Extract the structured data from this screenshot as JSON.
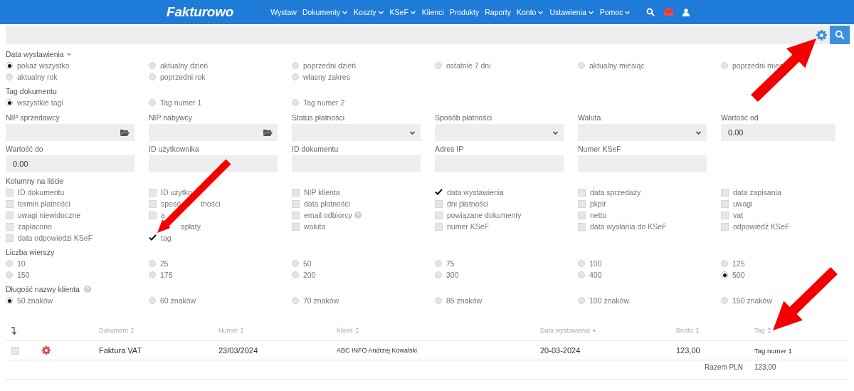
{
  "nav": {
    "logo": "Fakturowo",
    "items": [
      {
        "label": "Wystaw",
        "dropdown": false
      },
      {
        "label": "Dokumenty",
        "dropdown": true
      },
      {
        "label": "Koszty",
        "dropdown": true
      },
      {
        "label": "KSeF",
        "dropdown": true
      },
      {
        "label": "Klienci",
        "dropdown": false
      },
      {
        "label": "Produkty",
        "dropdown": false
      },
      {
        "label": "Raporty",
        "dropdown": false
      },
      {
        "label": "Konto",
        "dropdown": true
      },
      {
        "label": "Ustawienia",
        "dropdown": true
      },
      {
        "label": "Pomoc",
        "dropdown": true
      }
    ]
  },
  "date_filter": {
    "label": "Data wystawienia",
    "options": [
      {
        "label": "pokaż wszystko",
        "selected": true
      },
      {
        "label": "aktualny dzień",
        "selected": false
      },
      {
        "label": "poprzedni dzień",
        "selected": false
      },
      {
        "label": "ostatnie 7 dni",
        "selected": false
      },
      {
        "label": "aktualny miesiąc",
        "selected": false
      },
      {
        "label": "poprzedni mies",
        "selected": false
      },
      {
        "label": "aktualny rok",
        "selected": false
      },
      {
        "label": "poprzedni rok",
        "selected": false
      },
      {
        "label": "własny zakres",
        "selected": false
      }
    ]
  },
  "tag_filter": {
    "label": "Tag dokumentu",
    "options": [
      {
        "label": "wszystkie tagi",
        "selected": true
      },
      {
        "label": "Tag numer 1",
        "selected": false
      },
      {
        "label": "Tag numer 2",
        "selected": false
      }
    ]
  },
  "fields": [
    {
      "label": "NIP sprzedawcy",
      "kind": "picker"
    },
    {
      "label": "NIP nabywcy",
      "kind": "picker"
    },
    {
      "label": "Status płatności",
      "kind": "select"
    },
    {
      "label": "Sposób płatności",
      "kind": "select"
    },
    {
      "label": "Waluta",
      "kind": "select"
    },
    {
      "label": "Wartość od",
      "kind": "text",
      "value": "0.00"
    },
    {
      "label": "Wartość do",
      "kind": "text",
      "value": "0.00"
    },
    {
      "label": "ID użytkownika",
      "kind": "text"
    },
    {
      "label": "ID dokumentu",
      "kind": "text"
    },
    {
      "label": "Adres IP",
      "kind": "text"
    },
    {
      "label": "Numer KSeF",
      "kind": "text"
    }
  ],
  "columns_filter": {
    "label": "Kolumny na liście",
    "options": [
      {
        "label": "ID dokumentu",
        "checked": false
      },
      {
        "label": "ID użytko",
        "checked": false
      },
      {
        "label": "NIP klienta",
        "checked": false
      },
      {
        "label": "data wystawienia",
        "checked": true
      },
      {
        "label": "data sprzedaży",
        "checked": false
      },
      {
        "label": "data zapisania",
        "checked": false
      },
      {
        "label": "termin płatności",
        "checked": false
      },
      {
        "label": "sposó",
        "tail": "tności",
        "checked": false
      },
      {
        "label": "data płatności",
        "checked": false
      },
      {
        "label": "dni płatności",
        "checked": false
      },
      {
        "label": "pkpir",
        "checked": false
      },
      {
        "label": "uwagi",
        "checked": false
      },
      {
        "label": "uwagi niewidoczne",
        "checked": false
      },
      {
        "label": "a",
        "checked": false
      },
      {
        "label": "email odbiorcy",
        "checked": false,
        "help": true
      },
      {
        "label": "powiązane dokumenty",
        "checked": false
      },
      {
        "label": "netto",
        "checked": false
      },
      {
        "label": "vat",
        "checked": false
      },
      {
        "label": "zapłacono",
        "checked": false
      },
      {
        "tail": "apłaty"
      },
      {
        "label": "waluta",
        "checked": false
      },
      {
        "label": "numer KSeF",
        "checked": false
      },
      {
        "label": "data wysłania do KSeF",
        "checked": false
      },
      {
        "label": "odpowiedź KSeF",
        "checked": false
      },
      {
        "label": "data odpowiedzi KSeF",
        "checked": false
      },
      {
        "label": "tag",
        "checked": true
      }
    ]
  },
  "rows_per_page": {
    "label": "Liczba wierszy",
    "options": [
      {
        "label": "10",
        "selected": false
      },
      {
        "label": "25",
        "selected": false
      },
      {
        "label": "50",
        "selected": false
      },
      {
        "label": "75",
        "selected": false
      },
      {
        "label": "100",
        "selected": false
      },
      {
        "label": "125",
        "selected": false
      },
      {
        "label": "150",
        "selected": false
      },
      {
        "label": "175",
        "selected": false
      },
      {
        "label": "200",
        "selected": false
      },
      {
        "label": "300",
        "selected": false
      },
      {
        "label": "400",
        "selected": false
      },
      {
        "label": "500",
        "selected": true
      }
    ]
  },
  "client_name_length": {
    "label": "Długość nazwy klienta",
    "help": true,
    "options": [
      {
        "label": "50 znaków",
        "selected": true
      },
      {
        "label": "60 znaków",
        "selected": false
      },
      {
        "label": "70 znaków",
        "selected": false
      },
      {
        "label": "85 znaków",
        "selected": false
      },
      {
        "label": "100 znaków",
        "selected": false
      },
      {
        "label": "150 znaków",
        "selected": false
      }
    ]
  },
  "table": {
    "columns": [
      {
        "label": "Dokument",
        "sorted": false
      },
      {
        "label": "Numer",
        "sorted": false
      },
      {
        "label": "Klient",
        "sorted": false
      },
      {
        "label": "Data wystawienia",
        "sorted": true
      },
      {
        "label": "Brutto",
        "sorted": false
      },
      {
        "label": "Tag",
        "sorted": false
      }
    ],
    "rows": [
      {
        "checked": false,
        "cells": [
          "Faktura VAT",
          "23/03/2024",
          "ABC INFO Andrzej Kowalski",
          "20-03-2024",
          "123,00",
          "Tag numer 1"
        ]
      }
    ],
    "total_label": "Razem PLN",
    "total_value": "123,00"
  }
}
